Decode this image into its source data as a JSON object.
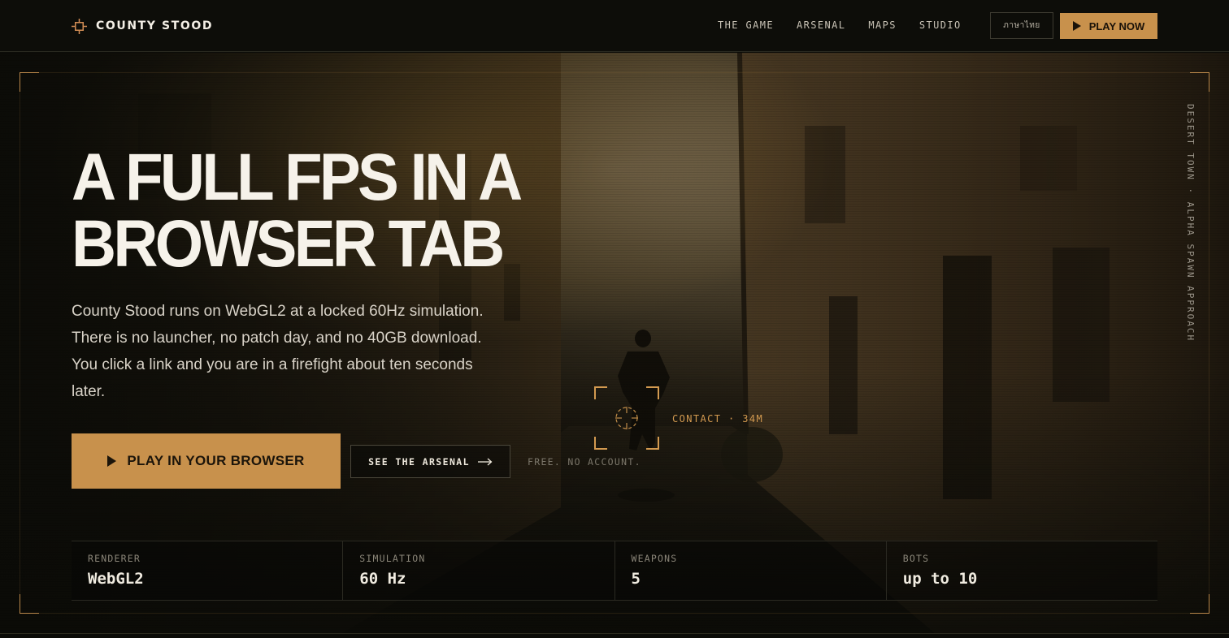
{
  "nav": {
    "brand_name": "COUNTY STOOD",
    "brand_icon": "crosshair-icon",
    "links": [
      "THE GAME",
      "ARSENAL",
      "MAPS",
      "STUDIO"
    ],
    "language_label": "ภาษาไทย",
    "play_now_label": "PLAY NOW"
  },
  "hero": {
    "side_caption": "DESERT TOWN · ALPHA SPAWN APPROACH",
    "headline_line1": "A FULL FPS IN A",
    "headline_line2": "BROWSER TAB",
    "lede": "County Stood runs on WebGL2 at a locked 60Hz simulation. There is no launcher, no patch day, and no 40GB download. You click a link and you are in a firefight about ten seconds later.",
    "cta_primary": "PLAY IN YOUR BROWSER",
    "cta_secondary": "SEE THE ARSENAL",
    "note": "FREE. NO ACCOUNT.",
    "target_readout": "CONTACT · 34M"
  },
  "stats": [
    {
      "label": "RENDERER",
      "value": "WebGL2"
    },
    {
      "label": "SIMULATION",
      "value": "60 Hz"
    },
    {
      "label": "WEAPONS",
      "value": "5"
    },
    {
      "label": "BOTS",
      "value": "up to 10"
    }
  ],
  "colors": {
    "accent": "#c8914c",
    "background": "#0c0c08",
    "text": "#f6f2ea"
  }
}
